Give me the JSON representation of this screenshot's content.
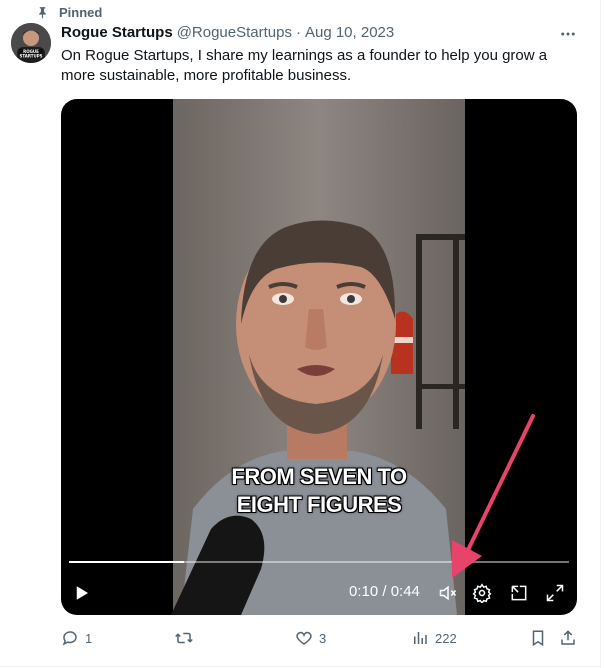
{
  "pinned": {
    "label": "Pinned",
    "icon": "pin-icon"
  },
  "author": {
    "display_name": "Rogue Startups",
    "handle": "@RogueStartups",
    "separator": "·",
    "date": "Aug 10, 2023",
    "avatar_text": "ROGUE STARTUPS"
  },
  "tweet": {
    "text": "On Rogue Startups, I share my learnings as a founder to help you grow a more sustainable, more profitable business."
  },
  "video": {
    "caption_line1": "FROM SEVEN TO",
    "caption_line2": "EIGHT FIGURES",
    "time_display": "0:10 / 0:44",
    "progress_fraction": 0.23,
    "controls": [
      "play-icon",
      "mute-icon",
      "settings-icon",
      "pip-icon",
      "fullscreen-icon"
    ]
  },
  "actions": {
    "reply_count": "1",
    "repost_count": "",
    "like_count": "3",
    "view_count": "222"
  },
  "colors": {
    "annotation_arrow": "#e8436a",
    "muted_text": "#536471"
  }
}
